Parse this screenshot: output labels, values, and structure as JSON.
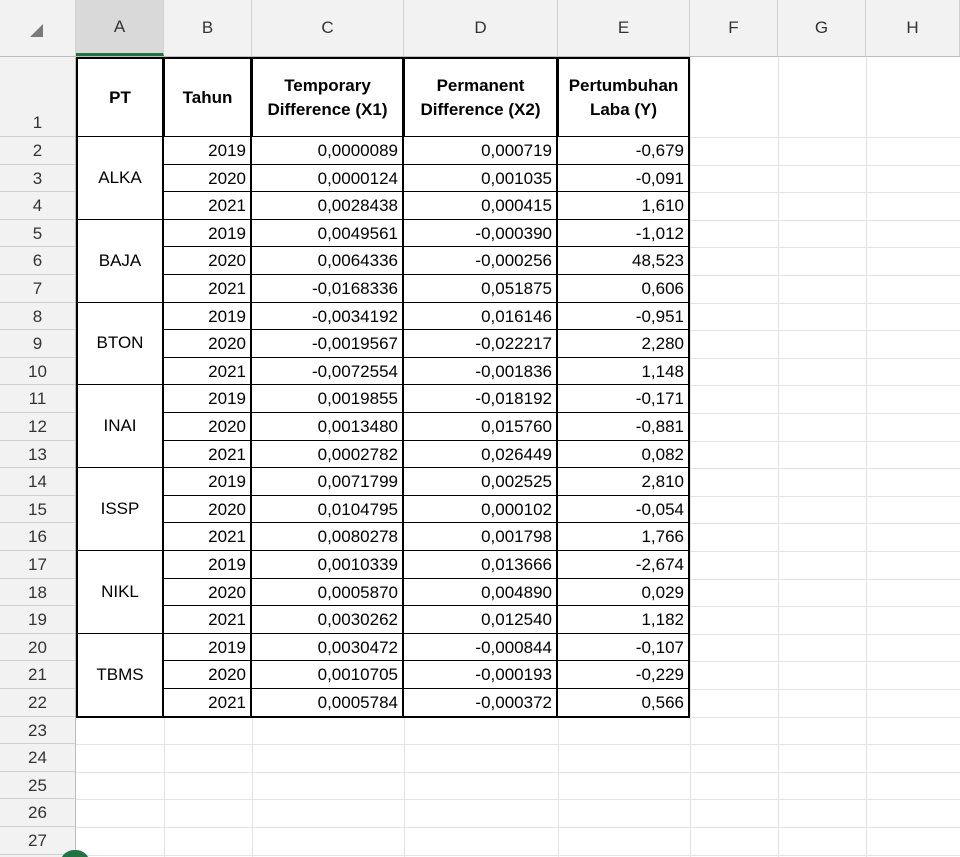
{
  "columns": [
    "A",
    "B",
    "C",
    "D",
    "E",
    "F",
    "G",
    "H"
  ],
  "selected_column": "A",
  "row_numbers": [
    "1",
    "2",
    "3",
    "4",
    "5",
    "6",
    "7",
    "8",
    "9",
    "10",
    "11",
    "12",
    "13",
    "14",
    "15",
    "16",
    "17",
    "18",
    "19",
    "20",
    "21",
    "22",
    "23",
    "24",
    "25",
    "26",
    "27"
  ],
  "table": {
    "headers": {
      "pt": "PT",
      "tahun": "Tahun",
      "x1_line1": "Temporary",
      "x1_line2": "Difference (X1)",
      "x2_line1": "Permanent",
      "x2_line2": "Difference (X2)",
      "y_line1": "Pertumbuhan",
      "y_line2": "Laba (Y)"
    },
    "companies": [
      {
        "name": "ALKA",
        "rows": [
          {
            "year": "2019",
            "x1": "0,0000089",
            "x2": "0,000719",
            "y": "-0,679"
          },
          {
            "year": "2020",
            "x1": "0,0000124",
            "x2": "0,001035",
            "y": "-0,091"
          },
          {
            "year": "2021",
            "x1": "0,0028438",
            "x2": "0,000415",
            "y": "1,610"
          }
        ]
      },
      {
        "name": "BAJA",
        "rows": [
          {
            "year": "2019",
            "x1": "0,0049561",
            "x2": "-0,000390",
            "y": "-1,012"
          },
          {
            "year": "2020",
            "x1": "0,0064336",
            "x2": "-0,000256",
            "y": "48,523"
          },
          {
            "year": "2021",
            "x1": "-0,0168336",
            "x2": "0,051875",
            "y": "0,606"
          }
        ]
      },
      {
        "name": "BTON",
        "rows": [
          {
            "year": "2019",
            "x1": "-0,0034192",
            "x2": "0,016146",
            "y": "-0,951"
          },
          {
            "year": "2020",
            "x1": "-0,0019567",
            "x2": "-0,022217",
            "y": "2,280"
          },
          {
            "year": "2021",
            "x1": "-0,0072554",
            "x2": "-0,001836",
            "y": "1,148"
          }
        ]
      },
      {
        "name": "INAI",
        "rows": [
          {
            "year": "2019",
            "x1": "0,0019855",
            "x2": "-0,018192",
            "y": "-0,171"
          },
          {
            "year": "2020",
            "x1": "0,0013480",
            "x2": "0,015760",
            "y": "-0,881"
          },
          {
            "year": "2021",
            "x1": "0,0002782",
            "x2": "0,026449",
            "y": "0,082"
          }
        ]
      },
      {
        "name": "ISSP",
        "rows": [
          {
            "year": "2019",
            "x1": "0,0071799",
            "x2": "0,002525",
            "y": "2,810"
          },
          {
            "year": "2020",
            "x1": "0,0104795",
            "x2": "0,000102",
            "y": "-0,054"
          },
          {
            "year": "2021",
            "x1": "0,0080278",
            "x2": "0,001798",
            "y": "1,766"
          }
        ]
      },
      {
        "name": "NIKL",
        "rows": [
          {
            "year": "2019",
            "x1": "0,0010339",
            "x2": "0,013666",
            "y": "-2,674"
          },
          {
            "year": "2020",
            "x1": "0,0005870",
            "x2": "0,004890",
            "y": "0,029"
          },
          {
            "year": "2021",
            "x1": "0,0030262",
            "x2": "0,012540",
            "y": "1,182"
          }
        ]
      },
      {
        "name": "TBMS",
        "rows": [
          {
            "year": "2019",
            "x1": "0,0030472",
            "x2": "-0,000844",
            "y": "-0,107"
          },
          {
            "year": "2020",
            "x1": "0,0010705",
            "x2": "-0,000193",
            "y": "-0,229"
          },
          {
            "year": "2021",
            "x1": "0,0005784",
            "x2": "-0,000372",
            "y": "0,566"
          }
        ]
      }
    ]
  },
  "colors": {
    "accent": "#217346",
    "header_bg": "#f2f2f2",
    "selected_header_bg": "#d9d9d9"
  },
  "icons": {
    "corner": "select-all-triangle-icon"
  }
}
